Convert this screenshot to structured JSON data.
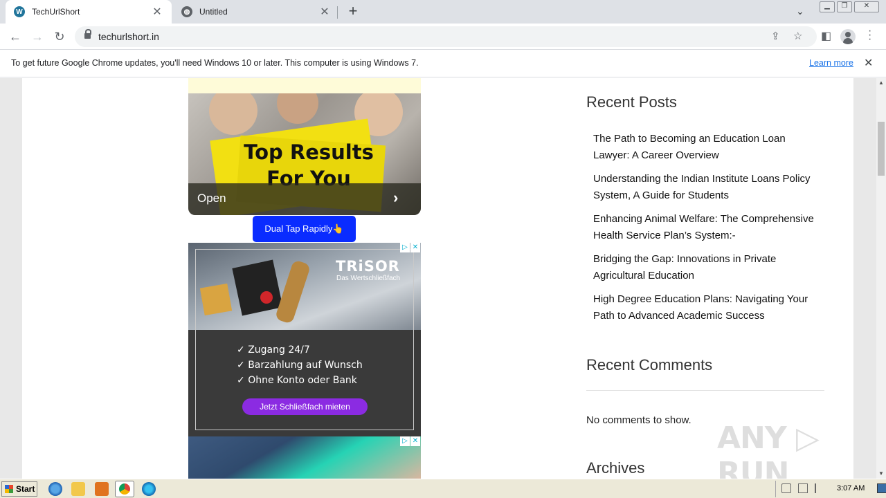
{
  "browser": {
    "tabs": [
      {
        "title": "TechUrlShort",
        "active": true,
        "favicon": "wordpress-icon"
      },
      {
        "title": "Untitled",
        "active": false,
        "favicon": "globe-icon"
      }
    ],
    "url": "techurlshort.in",
    "infobar": {
      "message": "To get future Google Chrome updates, you'll need Windows 10 or later. This computer is using Windows 7.",
      "link": "Learn more"
    }
  },
  "ads": {
    "ad1": {
      "headline_line1": "Top Results",
      "headline_line2": "For You",
      "action": "Open"
    },
    "dual_tap": "Dual Tap Rapidly👆",
    "ad2": {
      "brand": "TRiSOR",
      "tagline": "Das Wertschließfach",
      "features": [
        "Zugang 24/7",
        "Barzahlung auf Wunsch",
        "Ohne Konto oder Bank"
      ],
      "cta": "Jetzt Schließfach mieten"
    }
  },
  "sidebar": {
    "recent_posts_title": "Recent Posts",
    "posts": [
      "The Path to Becoming an Education Loan Lawyer: A Career Overview",
      "Understanding the Indian Institute Loans Policy System, A Guide for Students",
      "Enhancing Animal Welfare: The Comprehensive Health Service Plan’s System:-",
      "Bridging the Gap: Innovations in Private Agricultural Education",
      "High Degree Education Plans: Navigating Your Path to Advanced Academic Success"
    ],
    "recent_comments_title": "Recent Comments",
    "no_comments": "No comments to show.",
    "archives_title": "Archives"
  },
  "watermark": "ANY RUN",
  "taskbar": {
    "start": "Start",
    "clock": "3:07 AM"
  },
  "colors": {
    "dual_tap_button": "#0a2cff",
    "trisor_cta": "#8b2be2",
    "link": "#1a73e8"
  }
}
